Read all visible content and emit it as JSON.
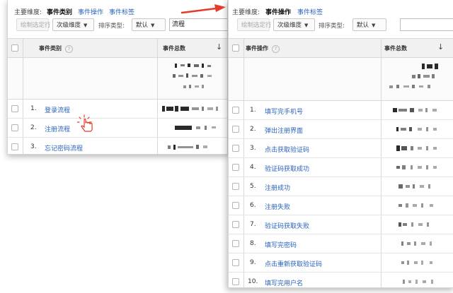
{
  "left": {
    "dimensions": {
      "label": "主要维度:",
      "selected": "事件类别",
      "links": [
        "事件操作",
        "事件标签"
      ]
    },
    "toolbar": {
      "plot_rows": "绘制选定行",
      "secondary": "次级维度",
      "sort_label": "排序类型:",
      "sort_value": "默认",
      "search_value": "流程"
    },
    "table": {
      "headers": {
        "name": "事件类别",
        "total": "事件总数"
      },
      "rows": [
        {
          "num": "1.",
          "label": "登录流程"
        },
        {
          "num": "2.",
          "label": "注册流程"
        },
        {
          "num": "3.",
          "label": "忘记密码流程"
        }
      ]
    }
  },
  "right": {
    "dimensions": {
      "label": "主要维度:",
      "selected": "事件操作",
      "links": [
        "事件标签"
      ]
    },
    "toolbar": {
      "plot_rows": "绘制选定行",
      "secondary": "次级维度",
      "sort_label": "排序类型:",
      "sort_value": "默认",
      "search_value": ""
    },
    "table": {
      "headers": {
        "name": "事件操作",
        "total": "事件总数"
      },
      "rows": [
        {
          "num": "1.",
          "label": "填写完手机号"
        },
        {
          "num": "2.",
          "label": "弹出注册界面"
        },
        {
          "num": "3.",
          "label": "点击获取验证码"
        },
        {
          "num": "4.",
          "label": "验证码获取成功"
        },
        {
          "num": "5.",
          "label": "注册成功"
        },
        {
          "num": "6.",
          "label": "注册失败"
        },
        {
          "num": "7.",
          "label": "验证码获取失败"
        },
        {
          "num": "8.",
          "label": "填写完密码"
        },
        {
          "num": "9.",
          "label": "点击重新获取验证码"
        },
        {
          "num": "10.",
          "label": "填写完用户名"
        }
      ]
    }
  },
  "icons": {
    "arrow": "red-arrow-icon",
    "pointer": "hand-pointer-icon",
    "sort": "sort-down-arrow-icon",
    "help": "help-icon",
    "caret": "caret-down-icon"
  },
  "colors": {
    "link": "#2a62bc",
    "arrow": "#e53b2a",
    "header_bg": "#f1f1f1"
  }
}
